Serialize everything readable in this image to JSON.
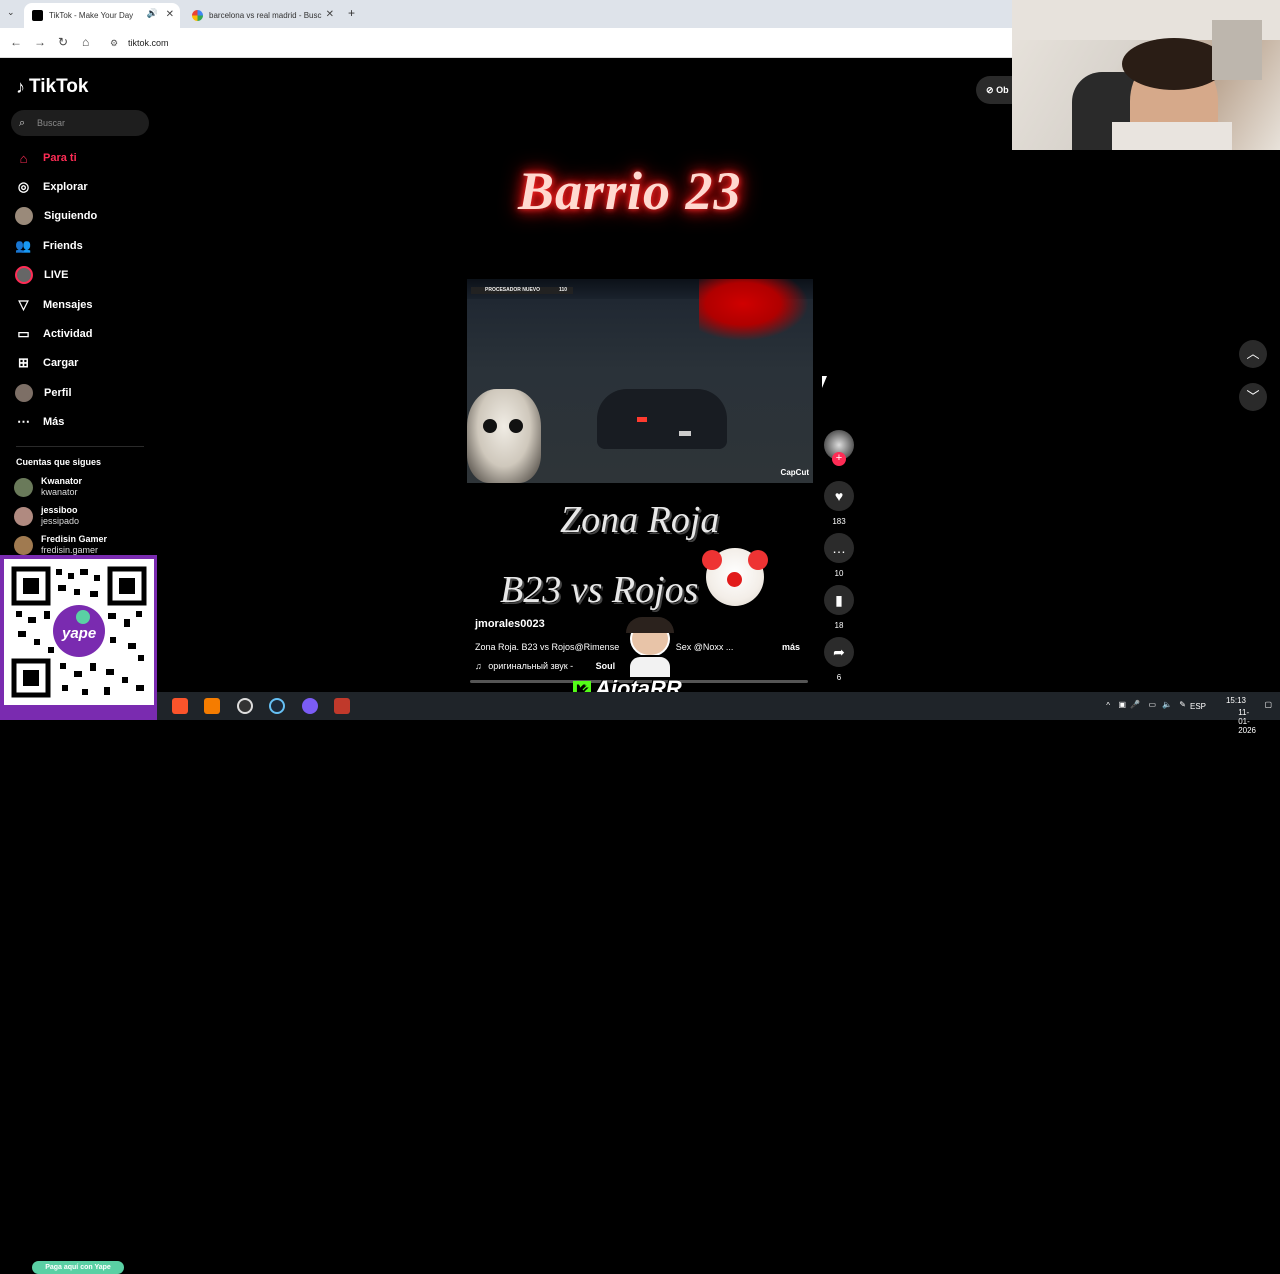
{
  "browser": {
    "tabs": [
      {
        "title": "TikTok - Make Your Day",
        "active": true
      },
      {
        "title": "barcelona vs real madrid - Busc",
        "active": false
      }
    ],
    "url": "tiktok.com"
  },
  "sidebar": {
    "logo": "TikTok",
    "search_placeholder": "Buscar",
    "nav": [
      {
        "label": "Para ti",
        "icon": "home-icon"
      },
      {
        "label": "Explorar",
        "icon": "compass-icon"
      },
      {
        "label": "Siguiendo",
        "icon": "avatar"
      },
      {
        "label": "Friends",
        "icon": "friends-icon"
      },
      {
        "label": "LIVE",
        "icon": "avatar"
      },
      {
        "label": "Mensajes",
        "icon": "send-icon"
      },
      {
        "label": "Actividad",
        "icon": "inbox-icon"
      },
      {
        "label": "Cargar",
        "icon": "upload-icon"
      },
      {
        "label": "Perfil",
        "icon": "avatar"
      },
      {
        "label": "Más",
        "icon": "more-icon"
      }
    ],
    "following_title": "Cuentas que sigues",
    "following": [
      {
        "name": "Kwanator",
        "handle": "kwanator"
      },
      {
        "name": "jessiboo",
        "handle": "jessipado"
      },
      {
        "name": "Fredisin Gamer",
        "handle": "fredisin.gamer"
      }
    ]
  },
  "qr": {
    "label": "Paga aquí con Yape",
    "brand": "yape"
  },
  "video": {
    "title_top": "Barrio 23",
    "hud_text": "PROCESADOR NUEVO",
    "hud_number": "110",
    "watermark": "CapCut",
    "zona_text": "Zona Roja",
    "versus_text": "B23 vs Rojos",
    "author": "jmorales0023",
    "description": "Zona Roja. B23 vs Rojos@Rimense",
    "description_tail": "Sex @Noxx ...",
    "more": "más",
    "sound": "оригинальный звук -",
    "sound_author": "Soul"
  },
  "actions": {
    "likes": "183",
    "comments": "10",
    "saves": "18",
    "shares": "6"
  },
  "obtener_label": "Ob",
  "taskbar": {
    "lang": "ESP",
    "time": "15:13",
    "date": "11-01-2026"
  },
  "overlay": {
    "streamer_name": "AjotaRR",
    "platform_letter": "K"
  },
  "colors": {
    "accent": "#fe2c55",
    "qr_bg": "#7a2bb0",
    "yape": "#5ad0a4"
  }
}
